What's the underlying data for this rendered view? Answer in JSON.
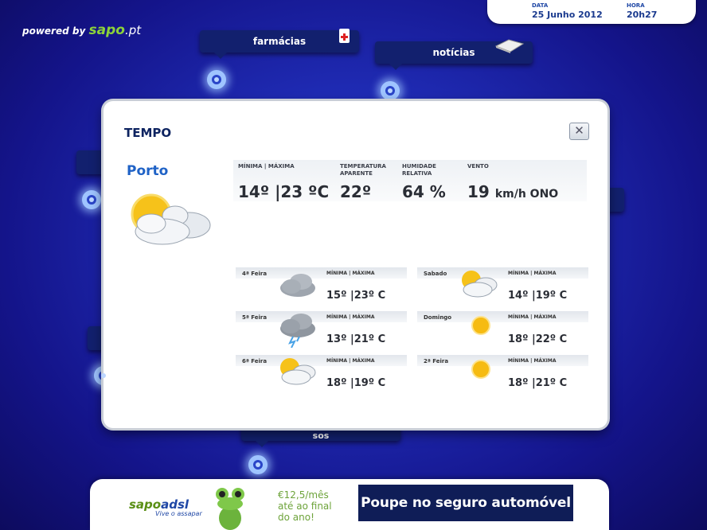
{
  "brand": {
    "powered": "powered by",
    "sapo": "sapo",
    "pt": ".pt"
  },
  "datebox": {
    "date_label": "DATA",
    "date": "25 Junho 2012",
    "time_label": "HORA",
    "time": "20h27"
  },
  "nav": {
    "farmacias": "farmácias",
    "noticias": "notícias",
    "sos": "sos"
  },
  "dialog": {
    "title": "TEMPO",
    "city": "Porto",
    "current": {
      "minmax_label": "MÍNIMA | MÁXIMA",
      "minmax": "14º |23 ºC",
      "apparent_label": "TEMPERATURA APARENTE",
      "apparent": "22º",
      "humidity_label": "HUMIDADE RELATIVA",
      "humidity": "64 %",
      "wind_label": "VENTO",
      "wind_value": "19",
      "wind_unit": "km/h ONO",
      "icon": "sun-cloud-icon"
    },
    "forecast": [
      {
        "day": "4ª Feira",
        "minmax_label": "MÍNIMA | MÁXIMA",
        "temp": "15º |23º C",
        "icon": "cloud-icon"
      },
      {
        "day": "Sabado",
        "minmax_label": "MÍNIMA | MÁXIMA",
        "temp": "14º |19º C",
        "icon": "sun-cloud-icon"
      },
      {
        "day": "5ª Feira",
        "minmax_label": "MÍNIMA | MÁXIMA",
        "temp": "13º |21º C",
        "icon": "storm-icon"
      },
      {
        "day": "Domingo",
        "minmax_label": "MÍNIMA | MÁXIMA",
        "temp": "18º |22º C",
        "icon": "sun-icon"
      },
      {
        "day": "6ª Feira",
        "minmax_label": "MÍNIMA | MÁXIMA",
        "temp": "18º |19º C",
        "icon": "sun-cloud-icon"
      },
      {
        "day": "2ª Feira",
        "minmax_label": "MÍNIMA | MÁXIMA",
        "temp": "18º |21º C",
        "icon": "sun-icon"
      }
    ]
  },
  "ad": {
    "sapo": "sapo",
    "adsl": "adsl",
    "tagline": "Vive o assapar",
    "offer": "€12,5/mês\naté ao final\ndo ano!",
    "banner": "Poupe no seguro automóvel"
  }
}
